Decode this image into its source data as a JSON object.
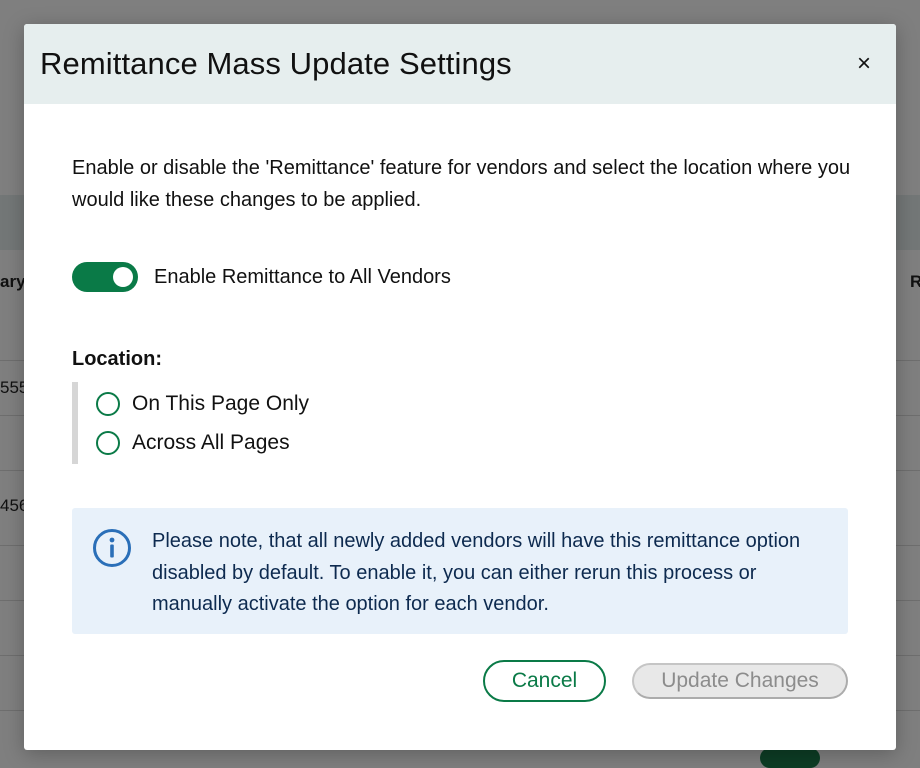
{
  "background": {
    "col_left_header": "ary",
    "col_right_header": "R",
    "row1_left": "555",
    "row2_left": "456"
  },
  "modal": {
    "title": "Remittance Mass Update Settings",
    "close_glyph": "×",
    "intro": "Enable or disable the 'Remittance' feature for vendors and select the location where you would like these changes to be applied.",
    "toggle": {
      "label": "Enable Remittance to All Vendors",
      "checked": true
    },
    "location": {
      "label": "Location:",
      "options": [
        {
          "label": "On This Page Only",
          "selected": false
        },
        {
          "label": "Across All Pages",
          "selected": false
        }
      ]
    },
    "info": {
      "icon": "info-circle-icon",
      "text": "Please note, that all newly added vendors will have this remittance option disabled by default. To enable it, you can either rerun this process or manually activate the option for each vendor."
    },
    "buttons": {
      "cancel": "Cancel",
      "update": "Update Changes"
    }
  },
  "colors": {
    "accent": "#0a7a47",
    "header_bg": "#e6eeee",
    "info_bg": "#e8f1fa",
    "info_icon": "#2a6fb8"
  }
}
